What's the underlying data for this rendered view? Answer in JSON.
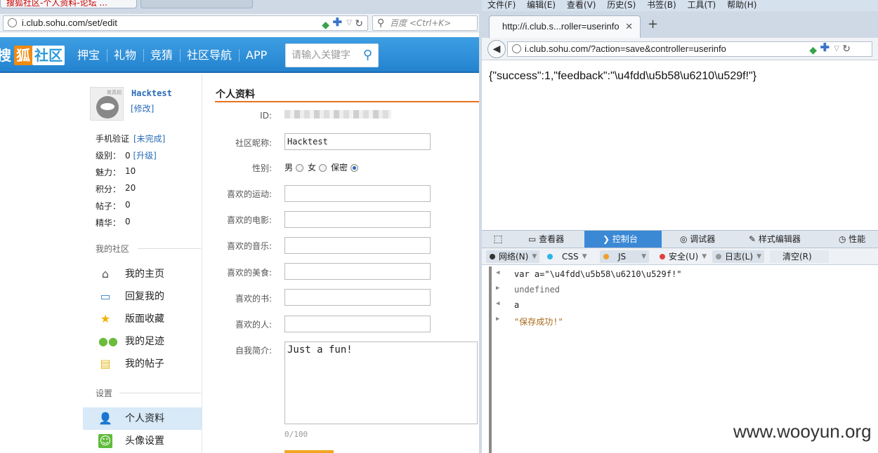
{
  "left_browser": {
    "tab_title": "搜狐社区-个人资料-论坛 ...",
    "url": "i.club.sohu.com/set/edit",
    "search_placeholder": "百度 <Ctrl+K>"
  },
  "site": {
    "logo_a": "搜",
    "logo_b": "狐",
    "logo_c": "社区",
    "nav": [
      "押宝",
      "礼物",
      "竞猜",
      "社区导航",
      "APP"
    ],
    "search_placeholder": "请输入关键字"
  },
  "profile": {
    "avatar_tag": "笑真相",
    "username": "Hacktest",
    "edit_link": "[修改]",
    "phone_label": "手机验证",
    "phone_value": "[未完成]",
    "level_label": "级别：",
    "level_value": "0",
    "level_link": "[升级]",
    "charm_label": "魅力：",
    "charm_value": "10",
    "points_label": "积分：",
    "points_value": "20",
    "posts_label": "帖子：",
    "posts_value": "0",
    "essence_label": "精华：",
    "essence_value": "0"
  },
  "sidebar": {
    "my_community_title": "我的社区",
    "items": [
      {
        "label": "我的主页",
        "icon": "house-icon"
      },
      {
        "label": "回复我的",
        "icon": "chat-icon"
      },
      {
        "label": "版面收藏",
        "icon": "star-icon"
      },
      {
        "label": "我的足迹",
        "icon": "footprint-icon"
      },
      {
        "label": "我的帖子",
        "icon": "note-icon"
      }
    ],
    "settings_title": "设置",
    "settings_items": [
      {
        "label": "个人资料",
        "icon": "person-icon"
      },
      {
        "label": "头像设置",
        "icon": "avatar-icon"
      }
    ]
  },
  "form": {
    "title": "个人资料",
    "id_label": "ID:",
    "nickname_label": "社区昵称:",
    "nickname_value": "Hacktest",
    "gender_label": "性别:",
    "gender_male": "男",
    "gender_female": "女",
    "gender_secret": "保密",
    "sports_label": "喜欢的运动:",
    "movies_label": "喜欢的电影:",
    "music_label": "喜欢的音乐:",
    "food_label": "喜欢的美食:",
    "books_label": "喜欢的书:",
    "people_label": "喜欢的人:",
    "bio_label": "自我简介:",
    "bio_value": "Just a fun!",
    "bio_count": "0/100"
  },
  "right_browser": {
    "menu": [
      "文件(F)",
      "编辑(E)",
      "查看(V)",
      "历史(S)",
      "书签(B)",
      "工具(T)",
      "帮助(H)"
    ],
    "tab_title": "http://i.club.s...roller=userinfo",
    "url": "i.club.sohu.com/?action=save&controller=userinfo",
    "response": "{\"success\":1,\"feedback\":\"\\u4fdd\\u5b58\\u6210\\u529f!\"}"
  },
  "devtools": {
    "tabs": [
      "查看器",
      "控制台",
      "调试器",
      "样式编辑器",
      "性能"
    ],
    "filters": [
      "网络(N)",
      "CSS",
      "JS",
      "安全(U)",
      "日志(L)",
      "清空(R)"
    ],
    "console": [
      "var a=\"\\u4fdd\\u5b58\\u6210\\u529f!\"",
      "undefined",
      "a",
      "\"保存成功!\""
    ]
  },
  "watermark": "www.wooyun.org"
}
